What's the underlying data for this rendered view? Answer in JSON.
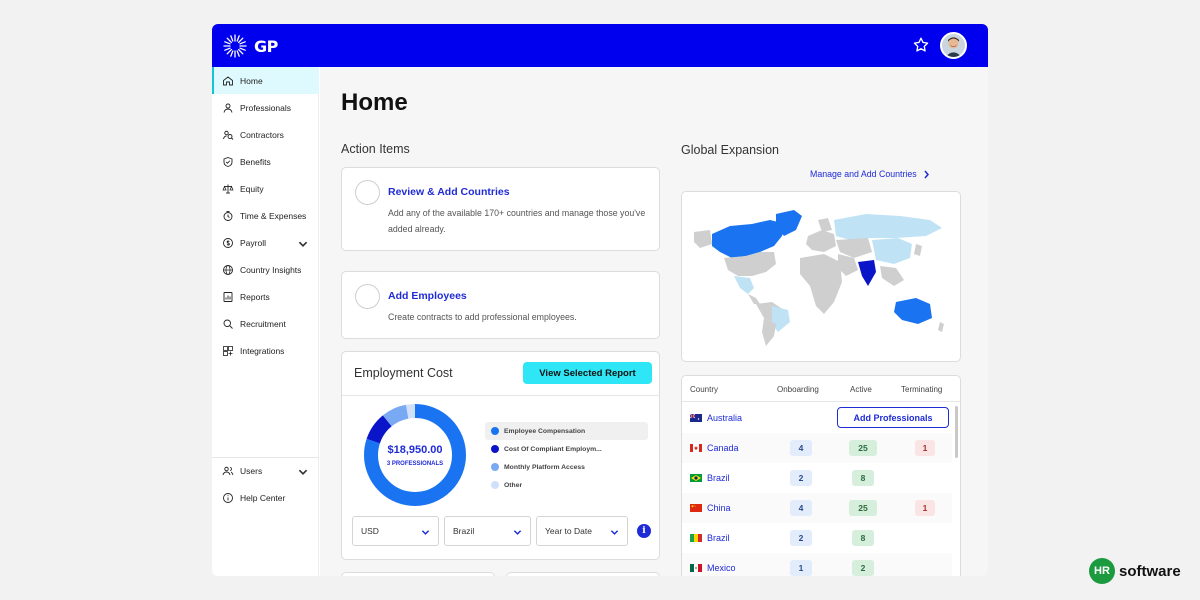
{
  "header": {
    "logo_text": "GP",
    "brand_color": "#0000ee"
  },
  "sidebar": {
    "items": [
      {
        "label": "Home",
        "icon": "home-icon"
      },
      {
        "label": "Professionals",
        "icon": "person-icon"
      },
      {
        "label": "Contractors",
        "icon": "contractor-icon"
      },
      {
        "label": "Benefits",
        "icon": "shield-icon"
      },
      {
        "label": "Equity",
        "icon": "scale-icon"
      },
      {
        "label": "Time & Expenses",
        "icon": "clock-icon"
      },
      {
        "label": "Payroll",
        "icon": "dollar-circle-icon"
      },
      {
        "label": "Country Insights",
        "icon": "globe-icon"
      },
      {
        "label": "Reports",
        "icon": "report-icon"
      },
      {
        "label": "Recruitment",
        "icon": "search-icon"
      },
      {
        "label": "Integrations",
        "icon": "integrations-icon"
      }
    ],
    "bottom": [
      {
        "label": "Users",
        "icon": "users-icon"
      },
      {
        "label": "Help Center",
        "icon": "info-icon"
      }
    ]
  },
  "main": {
    "title": "Home",
    "action_items": {
      "heading": "Action Items",
      "items": [
        {
          "title": "Review & Add Countries",
          "desc": "Add any of the available 170+ countries and manage those you've added already."
        },
        {
          "title": "Add Employees",
          "desc": "Create contracts to add professional employees."
        }
      ]
    },
    "employment_cost": {
      "title": "Employment Cost",
      "button": "View Selected Report",
      "amount": "$18,950.00",
      "sub": "3 PROFESSIONALS",
      "legend": [
        {
          "label": "Employee Compensation",
          "color": "#1a73f0"
        },
        {
          "label": "Cost Of Compliant Employm...",
          "color": "#0a14c8"
        },
        {
          "label": "Monthly Platform Access",
          "color": "#79a9f2"
        },
        {
          "label": "Other",
          "color": "#cfe0fb"
        }
      ],
      "shares": [
        0.8,
        0.09,
        0.08,
        0.03
      ],
      "selects": [
        "USD",
        "Brazil",
        "Year to Date"
      ],
      "info_glyph": "i"
    },
    "global_expansion": {
      "heading": "Global Expansion",
      "link": "Manage and Add Countries"
    },
    "country_table": {
      "headers": [
        "Country",
        "Onboarding",
        "Active",
        "Terminating"
      ],
      "add_button": "Add Professionals",
      "rows": [
        {
          "country": "Australia",
          "flag": "au",
          "onboarding": "",
          "active": "",
          "terminating": ""
        },
        {
          "country": "Canada",
          "flag": "ca",
          "onboarding": "4",
          "active": "25",
          "terminating": "1"
        },
        {
          "country": "Brazil",
          "flag": "br",
          "onboarding": "2",
          "active": "8",
          "terminating": ""
        },
        {
          "country": "China",
          "flag": "cn",
          "onboarding": "4",
          "active": "25",
          "terminating": "1"
        },
        {
          "country": "Brazil",
          "flag": "co",
          "onboarding": "2",
          "active": "8",
          "terminating": ""
        },
        {
          "country": "Mexico",
          "flag": "mx",
          "onboarding": "1",
          "active": "2",
          "terminating": ""
        }
      ]
    }
  },
  "watermark": {
    "badge": "HR",
    "word": "software"
  }
}
